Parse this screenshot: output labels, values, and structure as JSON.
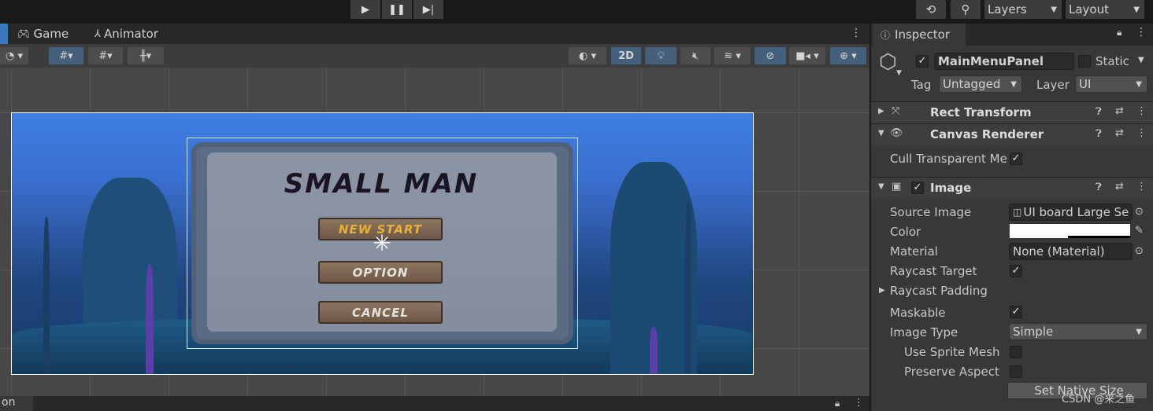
{
  "toolbar": {
    "play_icon": "play-icon",
    "pause_icon": "pause-icon",
    "step_icon": "step-icon",
    "layers_label": "Layers",
    "layout_label": "Layout"
  },
  "view_tabs": [
    {
      "label": "Game",
      "icon": "gamepad-icon"
    },
    {
      "label": "Animator",
      "icon": "animator-icon"
    }
  ],
  "scene_toolbar": {
    "mode_2d_label": "2D"
  },
  "game_ui": {
    "title": "SMALL   MAN",
    "buttons": [
      "NEW START",
      "OPTION",
      "CANCEL"
    ]
  },
  "bottom_tab": {
    "label": "on"
  },
  "inspector": {
    "tab_label": "Inspector",
    "object_name": "MainMenuPanel",
    "static_label": "Static",
    "tag_label": "Tag",
    "tag_value": "Untagged",
    "layer_label": "Layer",
    "layer_value": "UI",
    "components": {
      "rect_transform": "Rect Transform",
      "canvas_renderer": "Canvas Renderer",
      "image": "Image"
    },
    "canvas_renderer_fields": {
      "cull_transparent_label": "Cull Transparent Me"
    },
    "image_fields": {
      "source_image_label": "Source Image",
      "source_image_value": "UI board Large Se",
      "color_label": "Color",
      "material_label": "Material",
      "material_value": "None (Material)",
      "raycast_target_label": "Raycast Target",
      "raycast_padding_label": "Raycast Padding",
      "maskable_label": "Maskable",
      "image_type_label": "Image Type",
      "image_type_value": "Simple",
      "use_sprite_mesh_label": "Use Sprite Mesh",
      "preserve_aspect_label": "Preserve Aspect",
      "set_native_size_label": "Set Native Size"
    }
  },
  "watermark": "CSDN @来之鱼"
}
